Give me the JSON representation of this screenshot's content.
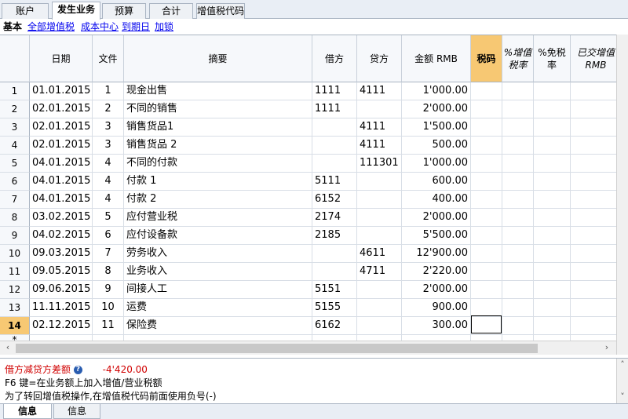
{
  "tabs": [
    {
      "label": "账户"
    },
    {
      "label": "发生业务"
    },
    {
      "label": "预算"
    },
    {
      "label": "合计"
    },
    {
      "label": "增值税代码"
    }
  ],
  "views": {
    "current": "基本",
    "links": [
      "全部增值税",
      "成本中心",
      "到期日",
      "加锁"
    ]
  },
  "columns": {
    "date": "日期",
    "doc": "文件",
    "desc": "摘要",
    "debit": "借方",
    "credit": "贷方",
    "amount": "金额 RMB",
    "vatcode": "税码",
    "vatpct_1": "%增值",
    "vatpct_2": "税率",
    "nonded_1": "%免税",
    "nonded_2": "率",
    "vatposted_1": "已交增值",
    "vatposted_2": "RMB"
  },
  "rows": [
    {
      "n": "1",
      "date": "01.01.2015",
      "doc": "1",
      "desc": "现金出售",
      "debit": "1111",
      "credit": "4111",
      "amount": "1'000.00"
    },
    {
      "n": "2",
      "date": "02.01.2015",
      "doc": "2",
      "desc": "不同的销售",
      "debit": "1111",
      "credit": "",
      "amount": "2'000.00"
    },
    {
      "n": "3",
      "date": "02.01.2015",
      "doc": "3",
      "desc": "销售货品1",
      "debit": "",
      "credit": "4111",
      "amount": "1'500.00"
    },
    {
      "n": "4",
      "date": "02.01.2015",
      "doc": "3",
      "desc": "销售货品 2",
      "debit": "",
      "credit": "4111",
      "amount": "500.00"
    },
    {
      "n": "5",
      "date": "04.01.2015",
      "doc": "4",
      "desc": "不同的付款",
      "debit": "",
      "credit": "111301",
      "amount": "1'000.00"
    },
    {
      "n": "6",
      "date": "04.01.2015",
      "doc": "4",
      "desc": "付款 1",
      "debit": "5111",
      "credit": "",
      "amount": "600.00"
    },
    {
      "n": "7",
      "date": "04.01.2015",
      "doc": "4",
      "desc": "付款 2",
      "debit": "6152",
      "credit": "",
      "amount": "400.00"
    },
    {
      "n": "8",
      "date": "03.02.2015",
      "doc": "5",
      "desc": "应付营业税",
      "debit": "2174",
      "credit": "",
      "amount": "2'000.00"
    },
    {
      "n": "9",
      "date": "04.02.2015",
      "doc": "6",
      "desc": "应付设备款",
      "debit": "2185",
      "credit": "",
      "amount": "5'500.00"
    },
    {
      "n": "10",
      "date": "09.03.2015",
      "doc": "7",
      "desc": "劳务收入",
      "debit": "",
      "credit": "4611",
      "amount": "12'900.00"
    },
    {
      "n": "11",
      "date": "09.05.2015",
      "doc": "8",
      "desc": "业务收入",
      "debit": "",
      "credit": "4711",
      "amount": "2'220.00"
    },
    {
      "n": "12",
      "date": "09.06.2015",
      "doc": "9",
      "desc": "间接人工",
      "debit": "5151",
      "credit": "",
      "amount": "2'000.00"
    },
    {
      "n": "13",
      "date": "11.11.2015",
      "doc": "10",
      "desc": "运费",
      "debit": "5155",
      "credit": "",
      "amount": "900.00"
    },
    {
      "n": "14",
      "date": "02.12.2015",
      "doc": "11",
      "desc": "保险费",
      "debit": "6162",
      "credit": "",
      "amount": "300.00"
    }
  ],
  "next_row": "*",
  "info": {
    "diff_label": "借方减贷方差额",
    "diff_value": "-4'420.00",
    "line2": "F6 键=在业务额上加入增值/营业税额",
    "line3": "为了转回增值税操作,在增值税代码前面使用负号(-)"
  },
  "bottom_tabs": [
    {
      "label": "信息"
    },
    {
      "label": "信息"
    }
  ],
  "colors": {
    "accent": "#f7c873",
    "red": "#d00000",
    "link": "#0000ee"
  }
}
